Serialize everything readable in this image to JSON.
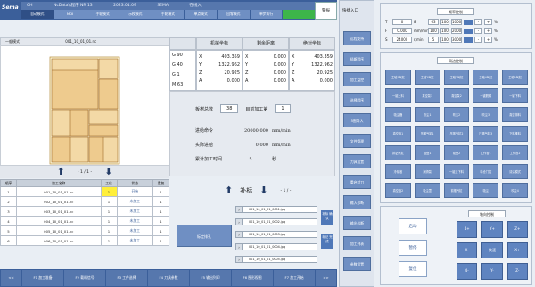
{
  "topbar": {
    "logo": "Sema",
    "info": [
      "CH",
      "NcData\\\\程序 NR 13",
      "2023.01.09",
      "SEMA",
      "在线入"
    ],
    "alarm": "警报"
  },
  "modes": [
    {
      "label": "自动模式",
      "state": "active"
    },
    {
      "label": "MDI",
      "state": ""
    },
    {
      "label": "手轮模式",
      "state": ""
    },
    {
      "label": "示校模式",
      "state": ""
    },
    {
      "label": "手轮模式",
      "state": ""
    },
    {
      "label": "单点模式",
      "state": ""
    },
    {
      "label": "回零模式",
      "state": ""
    },
    {
      "label": "单步执行",
      "state": ""
    },
    {
      "label": "",
      "state": "green"
    }
  ],
  "left": {
    "tab_label": "一般模式",
    "file_path": "001_10_01_01.nc",
    "pager": "- 1 / 1 -",
    "table_headers": [
      "顺序",
      "加工名称",
      "工位",
      "状态",
      "重复"
    ],
    "rows": [
      {
        "n": "1",
        "name": "001_10_01_01.nc",
        "pos": "1",
        "state": "开始",
        "rep": "1"
      },
      {
        "n": "2",
        "name": "002_10_01_01.nc",
        "pos": "1",
        "state": "未加工",
        "rep": "1"
      },
      {
        "n": "3",
        "name": "003_10_01_01.nc",
        "pos": "1",
        "state": "未加工",
        "rep": "1"
      },
      {
        "n": "4",
        "name": "004_10_01_01.nc",
        "pos": "1",
        "state": "未加工",
        "rep": "1"
      },
      {
        "n": "5",
        "name": "005_10_01_01.nc",
        "pos": "1",
        "state": "未加工",
        "rep": "1"
      },
      {
        "n": "6",
        "name": "006_10_01_01.nc",
        "pos": "1",
        "state": "未加工",
        "rep": "1"
      }
    ]
  },
  "position": {
    "gcodes": [
      "G 90",
      "G 40",
      "G 1",
      "M 63"
    ],
    "headers": [
      "机械坐标",
      "剩余距离",
      "绝对坐标"
    ],
    "mech": [
      [
        "X",
        "403.359"
      ],
      [
        "Y",
        "1322.962"
      ],
      [
        "Z",
        "20.925"
      ],
      [
        "A",
        "0.000"
      ]
    ],
    "remain": [
      [
        "X",
        "0.000"
      ],
      [
        "Y",
        "0.000"
      ],
      [
        "Z",
        "0.000"
      ],
      [
        "A",
        "0.000"
      ]
    ],
    "abs": [
      [
        "X",
        "403.359"
      ],
      [
        "Y",
        "1322.962"
      ],
      [
        "Z",
        "20.925"
      ],
      [
        "A",
        "0.000"
      ]
    ]
  },
  "stats": {
    "total_label": "板材总数",
    "total": "38",
    "current_label": "目前加工第",
    "current": "1",
    "cmd_label": "进给命令",
    "cmd_value": "20000.000",
    "cmd_unit": "mm/min",
    "actual_label": "实际进给",
    "actual_value": "0.000",
    "actual_unit": "mm/min",
    "time_label": "累计加工时间",
    "time_value": "5",
    "time_unit": "秒"
  },
  "offset": {
    "title": "补标",
    "pager": "- 1 / -",
    "button": "标定排孔",
    "rows": [
      "001_10_01_01_0001.jpg",
      "001_10_01_01_0002.jpg",
      "001_10_01_01_0003.jpg",
      "001_10_01_01_0004.jpg",
      "001_10_01_01_0005.jpg"
    ],
    "side_buttons": [
      "补标 确认",
      "标记 完成"
    ]
  },
  "fkeys": [
    "<<",
    "F1 加工准备",
    "F2 载料信号",
    "F3 工件选择",
    "F4 刀具参数",
    "F5 输出列印",
    "F6 图形视图",
    "F7 加工开始",
    ">>"
  ],
  "quick": {
    "title": "快捷入口",
    "buttons": [
      "远程支持",
      "插断程序",
      "加工监控",
      "选择程序",
      "5图导入",
      "文件管理",
      "刀具设置",
      "重启对刀",
      "输入诊断",
      "输出诊断",
      "加工列表",
      "参数设置"
    ]
  },
  "feed": {
    "title": "频率控制",
    "rows": [
      {
        "a": "T",
        "b": "0",
        "c": "8",
        "d": "63",
        "e": "100",
        "f": "1000",
        "g": "%"
      },
      {
        "a": "F",
        "b": "0.000",
        "c": "mm/min",
        "d": "100",
        "e": "100",
        "f": "2000",
        "g": "%"
      },
      {
        "a": "S",
        "b": "24000",
        "c": "r/min",
        "d": "5",
        "e": "100",
        "f": "3000",
        "g": "%"
      }
    ]
  },
  "periph": {
    "title": "周边控制",
    "grid": [
      [
        "主轴1气缸",
        "主轴2气缸",
        "主轴3气缸",
        "主轴4气缸",
        "主轴5气缸"
      ],
      [
        "一键上料",
        "真空泵1",
        "真空泵2",
        "一键脱模",
        "一键下料"
      ],
      [
        "吸尘器",
        "吹尘1",
        "吹尘2",
        "吹尘3",
        "真空排料"
      ],
      [
        "真空吸1",
        "压紧气缸1",
        "压紧气缸2",
        "压紧气缸3",
        "下料推料"
      ],
      [
        "排钻气缸",
        "吸盘1",
        "吸盘2",
        "工作台1",
        "工作台2"
      ],
      [
        "冷却液",
        "润滑泵",
        "一键上下料",
        "料仓门控",
        "清洁模式"
      ],
      [
        "真空吸2",
        "吸尘罩",
        "前推气缸",
        "吸尘",
        "吹尘4"
      ]
    ]
  },
  "axis": {
    "title": "轴向控制",
    "start": "启动",
    "pause": "暂停",
    "reset": "复位",
    "grid": [
      "4+",
      "Y+",
      "Z+",
      "X-",
      "快速",
      "X+",
      "4-",
      "Y-",
      "Z-"
    ]
  }
}
